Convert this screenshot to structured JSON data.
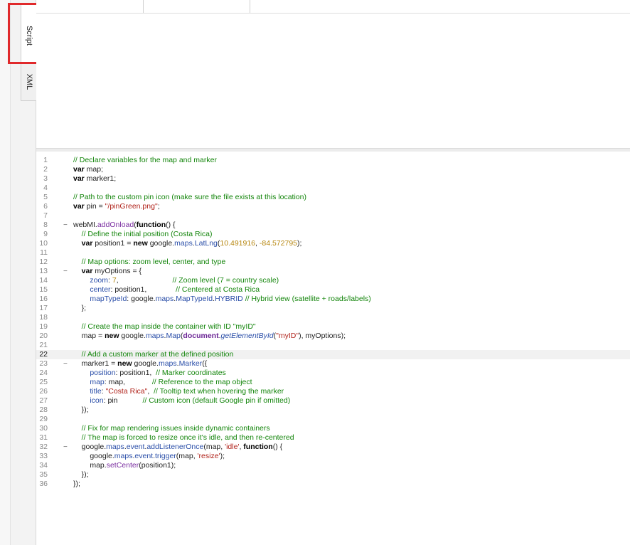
{
  "tabs": [
    {
      "label": "Script"
    },
    {
      "label": "XML"
    }
  ],
  "top_row": {
    "col1": "",
    "col2": "",
    "col3": ""
  },
  "editor": {
    "active_line": 22,
    "lines": [
      "1",
      "2",
      "3",
      "4",
      "5",
      "6",
      "7",
      "8",
      "9",
      "10",
      "11",
      "12",
      "13",
      "14",
      "15",
      "16",
      "17",
      "18",
      "19",
      "20",
      "21",
      "22",
      "23",
      "24",
      "25",
      "26",
      "27",
      "28",
      "29",
      "30",
      "31",
      "32",
      "33",
      "34",
      "35",
      "36"
    ]
  },
  "colors": {
    "highlight_box": "#e0292b",
    "comment": "#13850b",
    "string": "#b0221a",
    "number": "#b6860e",
    "property": "#2a4ea8"
  }
}
